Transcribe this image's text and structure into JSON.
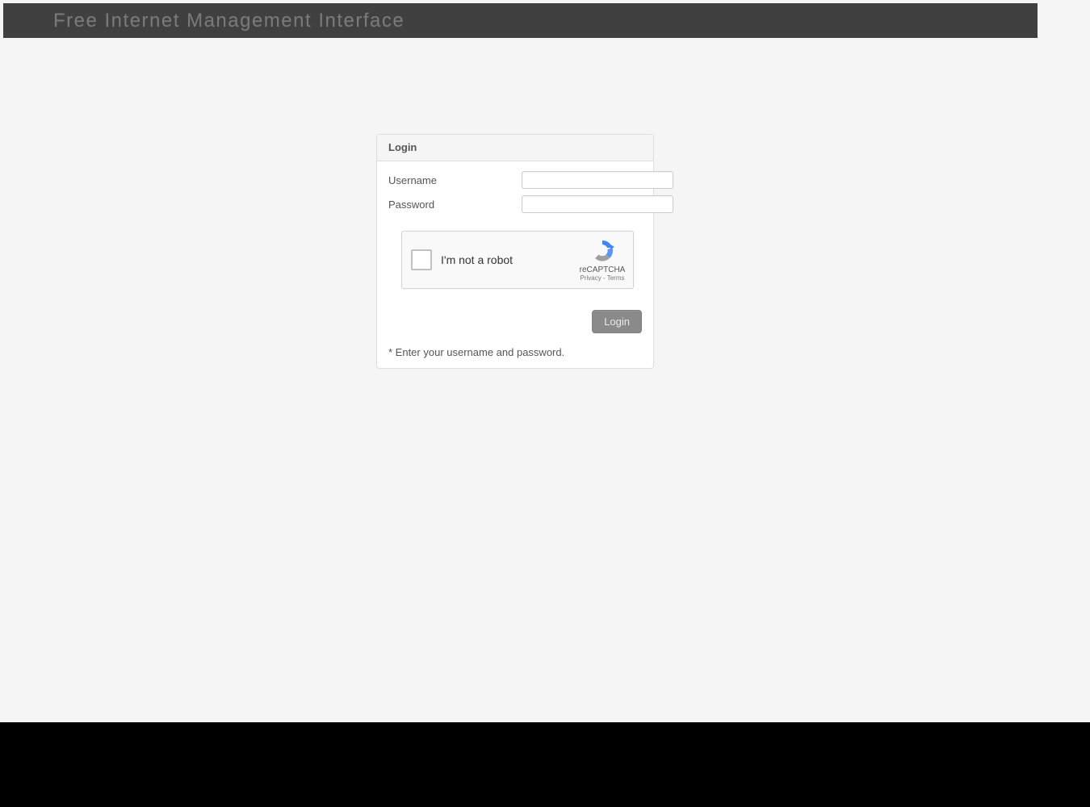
{
  "header": {
    "title": "Free Internet Management Interface"
  },
  "login": {
    "panel_title": "Login",
    "username_label": "Username",
    "username_value": "",
    "password_label": "Password",
    "password_value": "",
    "recaptcha": {
      "label": "I'm not a robot",
      "brand": "reCAPTCHA",
      "privacy": "Privacy",
      "separator": " - ",
      "terms": "Terms"
    },
    "login_button": "Login",
    "footnote": "* Enter your username and password."
  }
}
